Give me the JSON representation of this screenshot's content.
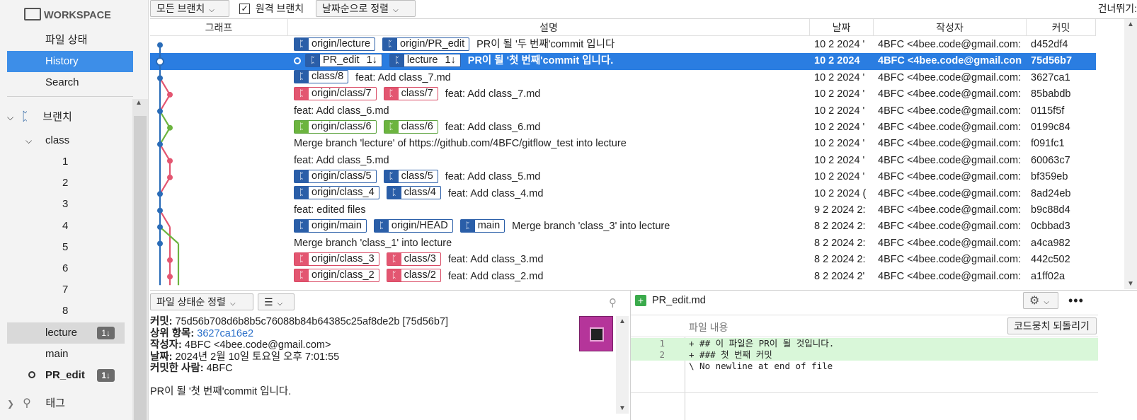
{
  "sidebar": {
    "workspace": "WORKSPACE",
    "items": [
      "파일 상태",
      "History",
      "Search"
    ],
    "branches_label": "브랜치",
    "class_folder": "class",
    "class_children": [
      "1",
      "2",
      "3",
      "4",
      "5",
      "6",
      "7",
      "8"
    ],
    "lecture": "lecture",
    "lecture_badge": "1↓",
    "main": "main",
    "pr_edit": "PR_edit",
    "pr_edit_badge": "1↓",
    "tags_label": "태그"
  },
  "toolbar": {
    "all_branches": "모든 브랜치",
    "remote_branch": "원격 브랜치",
    "remote_checked": true,
    "sort": "날짜순으로 정렬",
    "skip": "건너뛰기:"
  },
  "columns": {
    "graph": "그래프",
    "desc": "설명",
    "date": "날짜",
    "author": "작성자",
    "commit": "커밋"
  },
  "commits": [
    {
      "tags": [
        {
          "c": "blue",
          "t": "origin/lecture"
        },
        {
          "c": "blue",
          "t": "origin/PR_edit"
        }
      ],
      "msg": "PR이 될 '두 번째'commit 입니다",
      "date": "10 2 2024 '",
      "author": "4BFC <4bee.code@gmail.com:",
      "hash": "d452df4"
    },
    {
      "tags": [
        {
          "c": "blue",
          "t": "PR_edit",
          "n": "1↓"
        },
        {
          "c": "blue",
          "t": "lecture",
          "n": "1↓"
        }
      ],
      "msg": "PR이 될 '첫 번째'commit 입니다.",
      "date": "10 2 2024",
      "author": "4BFC <4bee.code@gmail.con",
      "hash": "75d56b7",
      "selected": true
    },
    {
      "tags": [
        {
          "c": "blue",
          "t": "class/8"
        }
      ],
      "msg": "feat: Add class_7.md",
      "date": "10 2 2024 '",
      "author": "4BFC <4bee.code@gmail.com:",
      "hash": "3627ca1"
    },
    {
      "tags": [
        {
          "c": "red",
          "t": "origin/class/7"
        },
        {
          "c": "red",
          "t": "class/7"
        }
      ],
      "msg": "feat: Add class_7.md",
      "date": "10 2 2024 '",
      "author": "4BFC <4bee.code@gmail.com:",
      "hash": "85babdb"
    },
    {
      "tags": [],
      "msg": "feat: Add class_6.md",
      "date": "10 2 2024 '",
      "author": "4BFC <4bee.code@gmail.com:",
      "hash": "0115f5f"
    },
    {
      "tags": [
        {
          "c": "green",
          "t": "origin/class/6"
        },
        {
          "c": "green",
          "t": "class/6"
        }
      ],
      "msg": "feat: Add class_6.md",
      "date": "10 2 2024 '",
      "author": "4BFC <4bee.code@gmail.com:",
      "hash": "0199c84"
    },
    {
      "tags": [],
      "msg": "Merge branch 'lecture' of https://github.com/4BFC/gitflow_test into lecture",
      "date": "10 2 2024 '",
      "author": "4BFC <4bee.code@gmail.com:",
      "hash": "f091fc1"
    },
    {
      "tags": [],
      "msg": "feat: Add class_5.md",
      "date": "10 2 2024 '",
      "author": "4BFC <4bee.code@gmail.com:",
      "hash": "60063c7"
    },
    {
      "tags": [
        {
          "c": "blue",
          "t": "origin/class/5"
        },
        {
          "c": "blue",
          "t": "class/5"
        }
      ],
      "msg": "feat: Add class_5.md",
      "date": "10 2 2024 '",
      "author": "4BFC <4bee.code@gmail.com:",
      "hash": "bf359eb"
    },
    {
      "tags": [
        {
          "c": "blue",
          "t": "origin/class_4"
        },
        {
          "c": "blue",
          "t": "class/4"
        }
      ],
      "msg": "feat: Add class_4.md",
      "date": "10 2 2024 (",
      "author": "4BFC <4bee.code@gmail.com:",
      "hash": "8ad24eb"
    },
    {
      "tags": [],
      "msg": "feat: edited files",
      "date": "9 2 2024 2:",
      "author": "4BFC <4bee.code@gmail.com:",
      "hash": "b9c88d4"
    },
    {
      "tags": [
        {
          "c": "blue",
          "t": "origin/main"
        },
        {
          "c": "blue",
          "t": "origin/HEAD"
        },
        {
          "c": "blue",
          "t": "main"
        }
      ],
      "msg": "Merge branch 'class_3' into lecture",
      "date": "8 2 2024 2:",
      "author": "4BFC <4bee.code@gmail.com:",
      "hash": "0cbbad3"
    },
    {
      "tags": [],
      "msg": "Merge branch 'class_1' into lecture",
      "date": "8 2 2024 2:",
      "author": "4BFC <4bee.code@gmail.com:",
      "hash": "a4ca982"
    },
    {
      "tags": [
        {
          "c": "red",
          "t": "origin/class_3"
        },
        {
          "c": "red",
          "t": "class/3"
        }
      ],
      "msg": "feat: Add class_3.md",
      "date": "8 2 2024 2:",
      "author": "4BFC <4bee.code@gmail.com:",
      "hash": "442c502"
    },
    {
      "tags": [
        {
          "c": "red",
          "t": "origin/class_2"
        },
        {
          "c": "red",
          "t": "class/2"
        }
      ],
      "msg": "feat: Add class_2.md",
      "date": "8 2 2024 2'",
      "author": "4BFC <4bee.code@gmail.com:",
      "hash": "a1ff02a"
    }
  ],
  "detail": {
    "sort_label": "파일 상태순 정렬",
    "commit_label": "커밋:",
    "commit_value": "75d56b708d6b8b5c76088b84b64385c25af8de2b [75d56b7]",
    "parent_label": "상위 항목:",
    "parent_value": "3627ca16e2",
    "author_label": "작성자:",
    "author_value": "4BFC <4bee.code@gmail.com>",
    "date_label": "날짜:",
    "date_value": "2024년 2월 10일 토요일 오후 7:01:55",
    "committer_label": "커밋한 사람:",
    "committer_value": "4BFC",
    "message": "PR이 될 '첫 번째'commit 입니다."
  },
  "diff": {
    "filename": "PR_edit.md",
    "file_content_label": "파일 내용",
    "revert_button": "코드뭉치 되돌리기",
    "lines": [
      {
        "n": "1",
        "text": "+ ## 이 파일은 PR이 될 것입니다.",
        "add": true
      },
      {
        "n": "2",
        "text": "+ ### 첫 번째 커밋",
        "add": true
      },
      {
        "n": "",
        "text": "\\ No newline at end of file",
        "add": false
      }
    ]
  },
  "colors": {
    "accent": "#2a7de1",
    "sidebar_selected": "#3d8ee8",
    "blue_branch": "#2a5ea8",
    "red_branch": "#e35671",
    "green_branch": "#6cb43f"
  }
}
